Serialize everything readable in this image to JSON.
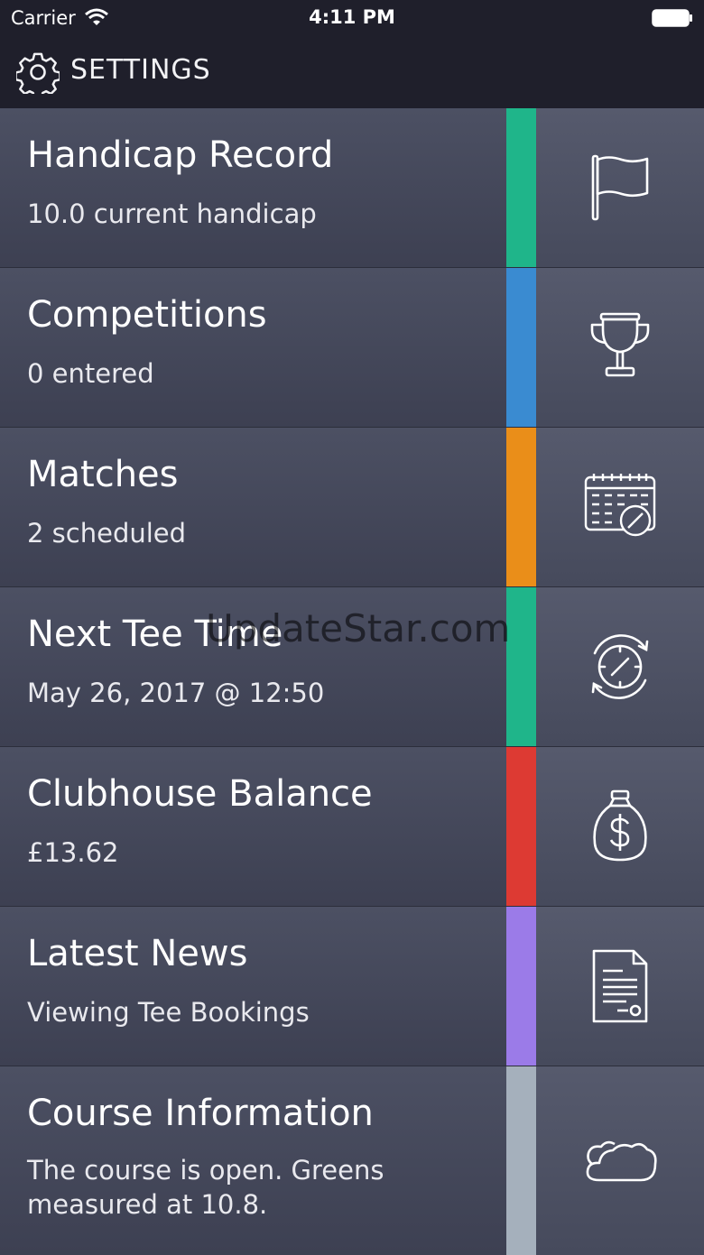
{
  "status": {
    "carrier": "Carrier",
    "time": "4:11 PM"
  },
  "header": {
    "title": "SETTINGS",
    "icon": "gear-icon"
  },
  "items": [
    {
      "label": "Handicap Record",
      "value": "10.0 current handicap",
      "accent": "#1fb58a",
      "icon": "flag-icon"
    },
    {
      "label": "Competitions",
      "value": "0 entered",
      "accent": "#3a8bd1",
      "icon": "trophy-icon"
    },
    {
      "label": "Matches",
      "value": "2 scheduled",
      "accent": "#ea8e19",
      "icon": "calendar-icon"
    },
    {
      "label": "Next Tee Time",
      "value": "May 26, 2017 @ 12:50",
      "accent": "#1fb58a",
      "icon": "clock-icon"
    },
    {
      "label": "Clubhouse Balance",
      "value": "£13.62",
      "accent": "#dd3a33",
      "icon": "money-bag-icon"
    },
    {
      "label": "Latest News",
      "value": "Viewing Tee Bookings",
      "accent": "#9b7be8",
      "icon": "document-icon"
    },
    {
      "label": "Course Information",
      "value": "The course is open. Greens measured at 10.8.",
      "accent": "#a5b0bc",
      "icon": "cloud-icon"
    }
  ],
  "watermark": "UpdateStar.com"
}
